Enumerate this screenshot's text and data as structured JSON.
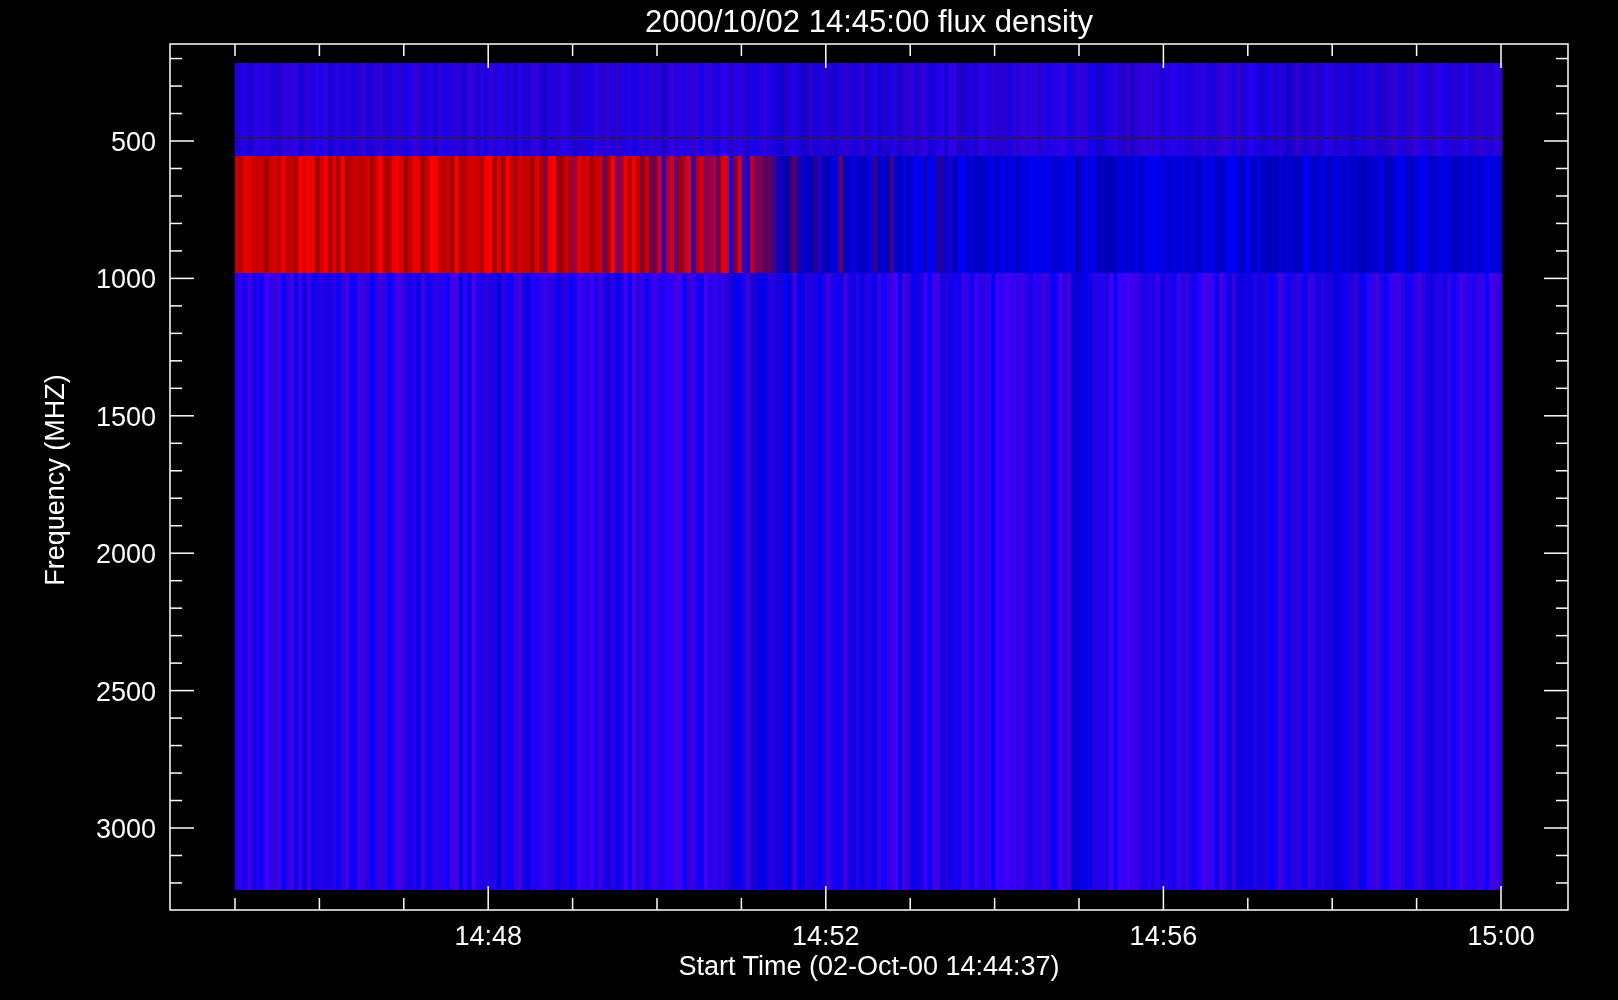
{
  "title": "2000/10/02 14:45:00 flux density",
  "y_axis": {
    "label": "Frequency (MHZ)",
    "tick_labels": [
      "500",
      "1000",
      "1500",
      "2000",
      "2500",
      "3000"
    ]
  },
  "x_axis": {
    "label": "Start Time (02-Oct-00 14:44:37)",
    "tick_labels": [
      "14:48",
      "14:52",
      "14:56",
      "15:00"
    ]
  }
}
